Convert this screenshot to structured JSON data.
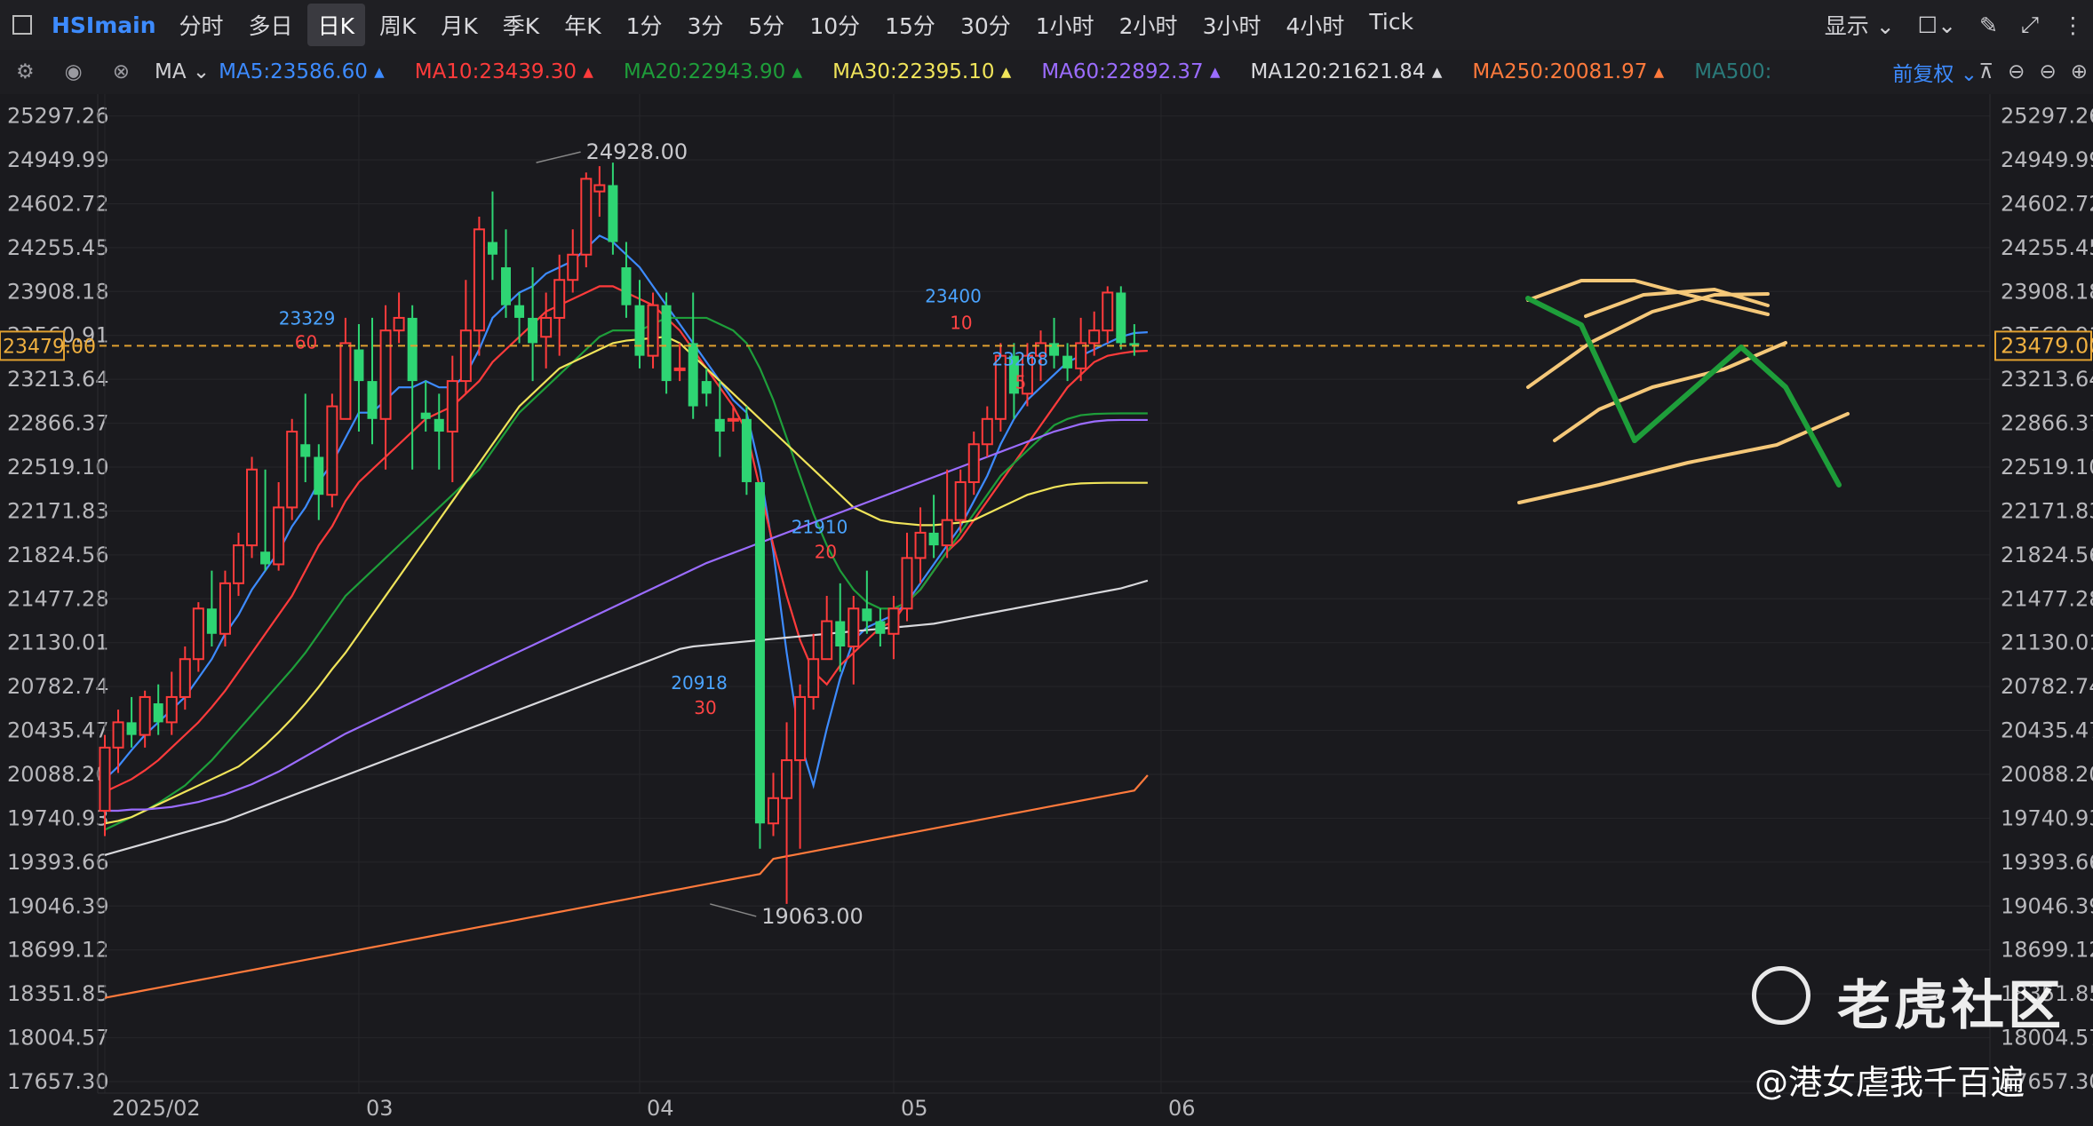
{
  "toolbar": {
    "symbol": "HSImain",
    "periods": [
      "分时",
      "多日",
      "日K",
      "周K",
      "月K",
      "季K",
      "年K",
      "1分",
      "3分",
      "5分",
      "10分",
      "15分",
      "30分",
      "1小时",
      "2小时",
      "3小时",
      "4小时",
      "Tick"
    ],
    "active_period": "日K",
    "display_label": "显示"
  },
  "ma_row": {
    "indicator": "MA",
    "items": [
      {
        "label": "MA5:23586.60",
        "color": "#3d8bff"
      },
      {
        "label": "MA10:23439.30",
        "color": "#ff3b3b"
      },
      {
        "label": "MA20:22943.90",
        "color": "#1e9e3a"
      },
      {
        "label": "MA30:22395.10",
        "color": "#f0e45a"
      },
      {
        "label": "MA60:22892.37",
        "color": "#9b6cff"
      },
      {
        "label": "MA120:21621.84",
        "color": "#d8d8dc"
      },
      {
        "label": "MA250:20081.97",
        "color": "#ff7a3c"
      },
      {
        "label": "MA500:",
        "color": "#2a7a7a"
      }
    ],
    "adjust": "前复权"
  },
  "watermark": {
    "brand": "老虎社区",
    "user": "@港女虐我千百遍"
  },
  "chart_data": {
    "type": "candlestick",
    "symbol": "HSImain",
    "period": "日K",
    "ylim": [
      17657.3,
      25470
    ],
    "y_ticks": [
      25297.26,
      24949.99,
      24602.72,
      24255.45,
      23908.18,
      23560.91,
      23213.64,
      22866.37,
      22519.1,
      22171.83,
      21824.56,
      21477.28,
      21130.01,
      20782.74,
      20435.47,
      20088.2,
      19740.93,
      19393.66,
      19046.39,
      18699.12,
      18351.85,
      18004.57,
      17657.3
    ],
    "x_labels": [
      {
        "label": "2025/02",
        "index": 0
      },
      {
        "label": "03",
        "index": 19
      },
      {
        "label": "04",
        "index": 40
      },
      {
        "label": "05",
        "index": 59
      },
      {
        "label": "06",
        "index": 79
      }
    ],
    "current_price": 23479.0,
    "annotations": [
      {
        "text": "24928.00",
        "type": "high",
        "index": 32,
        "value": 24928
      },
      {
        "text": "19063.00",
        "type": "low",
        "index": 45,
        "value": 19063
      },
      {
        "text": "23329",
        "index": 15,
        "value": 23329,
        "color": "#4aa3ff"
      },
      {
        "text": "60",
        "index": 15,
        "value": 23329,
        "color": "#ff4444"
      },
      {
        "text": "23400",
        "index": 64,
        "value": 23400,
        "color": "#4aa3ff"
      },
      {
        "text": "10",
        "index": 64,
        "value": 23400,
        "color": "#ff4444"
      },
      {
        "text": "23268",
        "index": 69,
        "value": 23268,
        "color": "#4aa3ff"
      },
      {
        "text": "5",
        "index": 69,
        "value": 23268,
        "color": "#ff4444"
      },
      {
        "text": "21910",
        "index": 54,
        "value": 21910,
        "color": "#4aa3ff"
      },
      {
        "text": "20",
        "index": 54,
        "value": 21910,
        "color": "#ff4444"
      },
      {
        "text": "20918",
        "index": 45,
        "value": 20918,
        "color": "#4aa3ff"
      },
      {
        "text": "30",
        "index": 45,
        "value": 20918,
        "color": "#ff4444"
      }
    ],
    "candles": [
      [
        19800,
        20300,
        20400,
        19600
      ],
      [
        20300,
        20500,
        20600,
        20100
      ],
      [
        20500,
        20400,
        20700,
        20300
      ],
      [
        20400,
        20700,
        20750,
        20300
      ],
      [
        20650,
        20500,
        20800,
        20400
      ],
      [
        20500,
        20700,
        20900,
        20400
      ],
      [
        20700,
        21000,
        21100,
        20600
      ],
      [
        21000,
        21400,
        21450,
        20900
      ],
      [
        21400,
        21200,
        21700,
        21100
      ],
      [
        21200,
        21600,
        21700,
        21100
      ],
      [
        21600,
        21900,
        22000,
        21500
      ],
      [
        21900,
        22500,
        22600,
        21800
      ],
      [
        21850,
        21750,
        22500,
        21700
      ],
      [
        21750,
        22200,
        22400,
        21700
      ],
      [
        22200,
        22800,
        22900,
        22100
      ],
      [
        22700,
        22600,
        23100,
        22400
      ],
      [
        22600,
        22300,
        22700,
        22100
      ],
      [
        22300,
        23000,
        23100,
        22200
      ],
      [
        22900,
        23500,
        23700,
        22900
      ],
      [
        23450,
        23200,
        23650,
        22800
      ],
      [
        23200,
        22900,
        23700,
        22700
      ],
      [
        22900,
        23600,
        23800,
        22500
      ],
      [
        23600,
        23700,
        23900,
        23500
      ],
      [
        23700,
        23200,
        23800,
        22500
      ],
      [
        22950,
        22900,
        23200,
        22800
      ],
      [
        22900,
        22800,
        23100,
        22500
      ],
      [
        22800,
        23200,
        23400,
        22400
      ],
      [
        23200,
        23600,
        24000,
        23100
      ],
      [
        23600,
        24400,
        24500,
        23400
      ],
      [
        24300,
        24200,
        24700,
        24000
      ],
      [
        24100,
        23800,
        24400,
        23700
      ],
      [
        23800,
        23700,
        23900,
        23500
      ],
      [
        23700,
        23500,
        24100,
        23200
      ],
      [
        23550,
        23700,
        23900,
        23300
      ],
      [
        23700,
        24000,
        24200,
        23400
      ],
      [
        24000,
        24200,
        24400,
        23900
      ],
      [
        24200,
        24800,
        24850,
        24100
      ],
      [
        24700,
        24750,
        24900,
        24500
      ],
      [
        24750,
        24300,
        24928,
        24200
      ],
      [
        24100,
        23800,
        24300,
        23700
      ],
      [
        23800,
        23400,
        24000,
        23300
      ],
      [
        23400,
        23800,
        23900,
        23300
      ],
      [
        23800,
        23200,
        23900,
        23100
      ],
      [
        23300,
        23300,
        23500,
        23200
      ],
      [
        23500,
        23000,
        23900,
        22900
      ],
      [
        23200,
        23100,
        23300,
        23000
      ],
      [
        22900,
        22800,
        23200,
        22600
      ],
      [
        22900,
        22900,
        23000,
        22800
      ],
      [
        22900,
        22400,
        23000,
        22300
      ],
      [
        22400,
        19700,
        22400,
        19500
      ],
      [
        19700,
        19900,
        20100,
        19600
      ],
      [
        19900,
        20200,
        20500,
        19063
      ],
      [
        20200,
        20700,
        20800,
        19500
      ],
      [
        20700,
        21000,
        21200,
        20600
      ],
      [
        21000,
        21300,
        21500,
        21000
      ],
      [
        21300,
        21100,
        21600,
        20900
      ],
      [
        21100,
        21400,
        21500,
        20800
      ],
      [
        21400,
        21300,
        21700,
        21200
      ],
      [
        21300,
        21200,
        21400,
        21100
      ],
      [
        21200,
        21400,
        21500,
        21000
      ],
      [
        21400,
        21800,
        22000,
        21300
      ],
      [
        21800,
        22000,
        22200,
        21600
      ],
      [
        22000,
        21900,
        22300,
        21800
      ],
      [
        21900,
        22100,
        22500,
        21800
      ],
      [
        22100,
        22400,
        22500,
        22000
      ],
      [
        22400,
        22700,
        22800,
        22300
      ],
      [
        22700,
        22900,
        23000,
        22600
      ],
      [
        22900,
        23400,
        23500,
        22800
      ],
      [
        23400,
        23100,
        23500,
        22900
      ],
      [
        23100,
        23400,
        23500,
        23000
      ],
      [
        23400,
        23500,
        23600,
        23200
      ],
      [
        23500,
        23400,
        23700,
        23300
      ],
      [
        23400,
        23300,
        23500,
        23200
      ],
      [
        23300,
        23500,
        23700,
        23200
      ],
      [
        23500,
        23600,
        23750,
        23400
      ],
      [
        23600,
        23900,
        23950,
        23500
      ],
      [
        23900,
        23500,
        23950,
        23450
      ],
      [
        23500,
        23479,
        23650,
        23400
      ]
    ],
    "series": [
      {
        "name": "MA5",
        "color": "#3d8bff",
        "values": [
          20050,
          20150,
          20280,
          20400,
          20500,
          20600,
          20700,
          20850,
          21000,
          21200,
          21350,
          21550,
          21700,
          21850,
          22050,
          22200,
          22400,
          22550,
          22750,
          22950,
          22950,
          23050,
          23150,
          23150,
          23200,
          23150,
          23150,
          23250,
          23450,
          23700,
          23800,
          23900,
          23950,
          24050,
          24100,
          24150,
          24250,
          24350,
          24300,
          24200,
          24100,
          23950,
          23800,
          23650,
          23500,
          23350,
          23200,
          23050,
          22950,
          22500,
          21850,
          21050,
          20350,
          20000,
          20450,
          20850,
          21150,
          21250,
          21300,
          21350,
          21450,
          21600,
          21750,
          21900,
          22050,
          22250,
          22450,
          22700,
          22900,
          23050,
          23150,
          23250,
          23350,
          23400,
          23450,
          23500,
          23550,
          23580,
          23586
        ]
      },
      {
        "name": "MA10",
        "color": "#ff3b3b",
        "values": [
          19950,
          20000,
          20050,
          20120,
          20200,
          20300,
          20400,
          20500,
          20620,
          20750,
          20900,
          21050,
          21200,
          21350,
          21500,
          21700,
          21900,
          22050,
          22250,
          22400,
          22500,
          22600,
          22700,
          22800,
          22900,
          22950,
          23000,
          23100,
          23200,
          23350,
          23450,
          23550,
          23650,
          23750,
          23800,
          23850,
          23900,
          23950,
          23950,
          23900,
          23850,
          23800,
          23700,
          23600,
          23450,
          23300,
          23150,
          23000,
          22800,
          22350,
          21900,
          21500,
          21150,
          20900,
          20800,
          20950,
          21050,
          21150,
          21250,
          21300,
          21450,
          21550,
          21700,
          21850,
          21950,
          22100,
          22250,
          22400,
          22550,
          22700,
          22850,
          23000,
          23150,
          23250,
          23350,
          23400,
          23420,
          23435,
          23439
        ]
      },
      {
        "name": "MA20",
        "color": "#1e9e3a",
        "values": [
          19650,
          19700,
          19750,
          19800,
          19860,
          19930,
          20000,
          20100,
          20200,
          20320,
          20440,
          20560,
          20680,
          20800,
          20920,
          21050,
          21200,
          21350,
          21500,
          21600,
          21700,
          21800,
          21900,
          22000,
          22100,
          22200,
          22300,
          22400,
          22500,
          22650,
          22800,
          22950,
          23050,
          23150,
          23250,
          23350,
          23450,
          23550,
          23600,
          23600,
          23600,
          23650,
          23700,
          23700,
          23700,
          23700,
          23650,
          23600,
          23500,
          23300,
          23050,
          22750,
          22450,
          22150,
          21900,
          21700,
          21550,
          21450,
          21400,
          21400,
          21450,
          21550,
          21700,
          21850,
          22000,
          22150,
          22300,
          22450,
          22550,
          22650,
          22750,
          22850,
          22900,
          22930,
          22940,
          22943,
          22944,
          22944,
          22944
        ]
      },
      {
        "name": "MA30",
        "color": "#f0e45a",
        "values": [
          19700,
          19720,
          19750,
          19800,
          19850,
          19900,
          19950,
          20000,
          20050,
          20100,
          20150,
          20230,
          20320,
          20420,
          20530,
          20650,
          20780,
          20920,
          21050,
          21200,
          21350,
          21500,
          21650,
          21800,
          21950,
          22100,
          22250,
          22400,
          22550,
          22700,
          22850,
          23000,
          23100,
          23200,
          23300,
          23350,
          23400,
          23450,
          23500,
          23520,
          23530,
          23540,
          23550,
          23500,
          23400,
          23300,
          23200,
          23100,
          23000,
          22900,
          22800,
          22700,
          22600,
          22500,
          22400,
          22300,
          22200,
          22150,
          22100,
          22080,
          22070,
          22060,
          22060,
          22070,
          22080,
          22100,
          22150,
          22200,
          22250,
          22300,
          22330,
          22360,
          22380,
          22390,
          22393,
          22395,
          22395,
          22395,
          22395
        ]
      },
      {
        "name": "MA60",
        "color": "#9b6cff",
        "values": [
          19800,
          19800,
          19810,
          19810,
          19820,
          19830,
          19850,
          19870,
          19900,
          19930,
          19970,
          20010,
          20060,
          20110,
          20170,
          20230,
          20290,
          20350,
          20410,
          20460,
          20510,
          20560,
          20610,
          20660,
          20710,
          20760,
          20810,
          20860,
          20910,
          20960,
          21010,
          21060,
          21110,
          21160,
          21210,
          21260,
          21310,
          21360,
          21410,
          21460,
          21510,
          21560,
          21610,
          21660,
          21710,
          21760,
          21800,
          21840,
          21880,
          21920,
          21960,
          22000,
          22040,
          22080,
          22120,
          22160,
          22200,
          22240,
          22280,
          22320,
          22360,
          22400,
          22440,
          22480,
          22520,
          22560,
          22600,
          22640,
          22680,
          22720,
          22760,
          22800,
          22830,
          22860,
          22880,
          22890,
          22892,
          22892,
          22892
        ]
      },
      {
        "name": "MA120",
        "color": "#d8d8dc",
        "values": [
          19450,
          19480,
          19510,
          19540,
          19570,
          19600,
          19630,
          19660,
          19690,
          19720,
          19760,
          19800,
          19840,
          19880,
          19920,
          19960,
          20000,
          20040,
          20080,
          20120,
          20160,
          20200,
          20240,
          20280,
          20320,
          20360,
          20400,
          20440,
          20480,
          20520,
          20560,
          20600,
          20640,
          20680,
          20720,
          20760,
          20800,
          20840,
          20880,
          20920,
          20960,
          21000,
          21040,
          21080,
          21100,
          21110,
          21120,
          21130,
          21140,
          21150,
          21160,
          21170,
          21180,
          21190,
          21200,
          21210,
          21220,
          21230,
          21240,
          21250,
          21260,
          21270,
          21280,
          21300,
          21320,
          21340,
          21360,
          21380,
          21400,
          21420,
          21440,
          21460,
          21480,
          21500,
          21520,
          21540,
          21560,
          21590,
          21621
        ]
      },
      {
        "name": "MA250",
        "color": "#ff7a3c",
        "values": [
          18320,
          18340,
          18360,
          18380,
          18400,
          18420,
          18440,
          18460,
          18480,
          18500,
          18520,
          18540,
          18560,
          18580,
          18600,
          18620,
          18640,
          18660,
          18680,
          18700,
          18720,
          18740,
          18760,
          18780,
          18800,
          18820,
          18840,
          18860,
          18880,
          18900,
          18920,
          18940,
          18960,
          18980,
          19000,
          19020,
          19040,
          19060,
          19080,
          19100,
          19120,
          19140,
          19160,
          19180,
          19200,
          19220,
          19240,
          19260,
          19280,
          19300,
          19420,
          19440,
          19460,
          19480,
          19500,
          19520,
          19540,
          19560,
          19580,
          19600,
          19620,
          19640,
          19660,
          19680,
          19700,
          19720,
          19740,
          19760,
          19780,
          19800,
          19820,
          19840,
          19860,
          19880,
          19900,
          19920,
          19940,
          19960,
          20081
        ]
      }
    ]
  }
}
